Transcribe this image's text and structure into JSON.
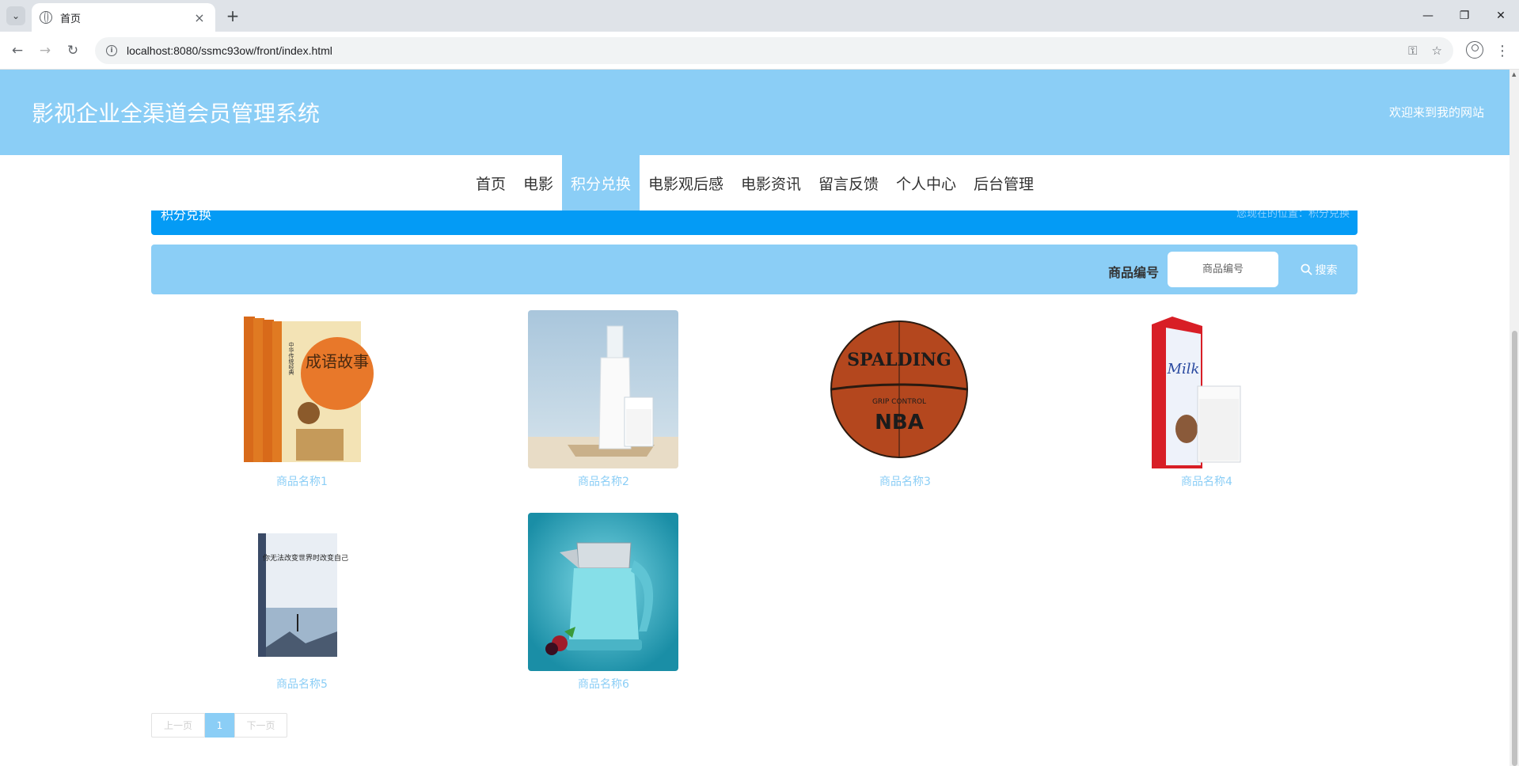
{
  "browser": {
    "tab_title": "首页",
    "url": "localhost:8080/ssmc93ow/front/index.html"
  },
  "header": {
    "site_title": "影视企业全渠道会员管理系统",
    "welcome": "欢迎来到我的网站"
  },
  "nav": {
    "items": [
      {
        "label": "首页"
      },
      {
        "label": "电影"
      },
      {
        "label": "积分兑换"
      },
      {
        "label": "电影观后感"
      },
      {
        "label": "电影资讯"
      },
      {
        "label": "留言反馈"
      },
      {
        "label": "个人中心"
      },
      {
        "label": "后台管理"
      }
    ],
    "active": "积分兑换"
  },
  "breadcrumb": {
    "title": "积分兑换",
    "location": "您现在的位置：积分兑换"
  },
  "search": {
    "label": "商品编号",
    "placeholder": "商品编号",
    "button_label": "搜索"
  },
  "products": [
    {
      "name": "商品名称1",
      "image": "book-chengyu"
    },
    {
      "name": "商品名称2",
      "image": "milk-bottle"
    },
    {
      "name": "商品名称3",
      "image": "basketball"
    },
    {
      "name": "商品名称4",
      "image": "milk-carton"
    },
    {
      "name": "商品名称5",
      "image": "book-blue"
    },
    {
      "name": "商品名称6",
      "image": "electric-kettle"
    }
  ],
  "pagination": {
    "prev": "上一页",
    "current": "1",
    "next": "下一页"
  },
  "image_texts": {
    "book_title": "成语故事",
    "book_series": "中华传统经典",
    "ball_brand": "SPALDING",
    "ball_sub": "GRIP CONTROL",
    "ball_league": "NBA",
    "milk_label": "Milk",
    "book2_title": "你无法改变世界时改变自己"
  },
  "colors": {
    "primary": "#8bcef6",
    "breadcrumb_bg": "#049bf5"
  }
}
